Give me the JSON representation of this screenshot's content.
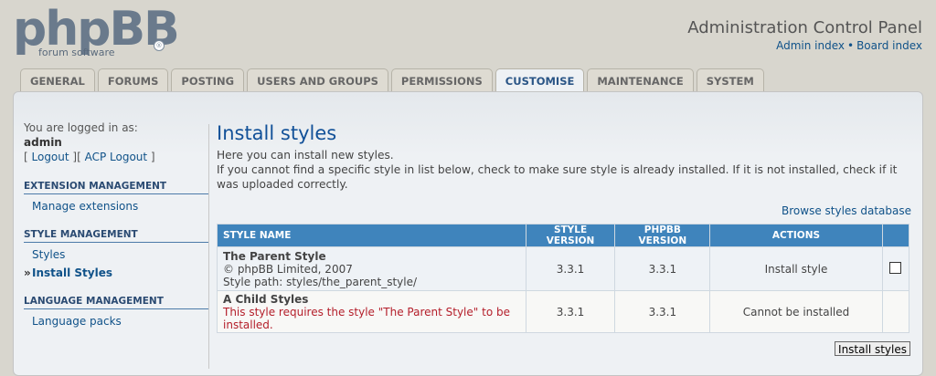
{
  "logo": {
    "text": "phpBB",
    "sub": "forum software",
    "mark": "®"
  },
  "header": {
    "title": "Administration Control Panel",
    "links": [
      "Admin index",
      "Board index"
    ],
    "separator": "•"
  },
  "tabs": [
    "GENERAL",
    "FORUMS",
    "POSTING",
    "USERS AND GROUPS",
    "PERMISSIONS",
    "CUSTOMISE",
    "MAINTENANCE",
    "SYSTEM"
  ],
  "active_tab": "CUSTOMISE",
  "sidebar": {
    "logged_in_label": "You are logged in as:",
    "username": "admin",
    "logout": "Logout",
    "acp_logout": "ACP Logout",
    "sections": [
      {
        "title": "EXTENSION MANAGEMENT",
        "items": [
          "Manage extensions"
        ]
      },
      {
        "title": "STYLE MANAGEMENT",
        "items": [
          "Styles",
          "Install Styles"
        ]
      },
      {
        "title": "LANGUAGE MANAGEMENT",
        "items": [
          "Language packs"
        ]
      }
    ],
    "active_item": "Install Styles"
  },
  "main": {
    "title": "Install styles",
    "desc1": "Here you can install new styles.",
    "desc2": "If you cannot find a specific style in list below, check to make sure style is already installed. If it is not installed, check if it was uploaded correctly.",
    "browse": "Browse styles database"
  },
  "table": {
    "headers": [
      "STYLE NAME",
      "STYLE VERSION",
      "PHPBB VERSION",
      "ACTIONS",
      ""
    ],
    "rows": [
      {
        "name": "The Parent Style",
        "copyright": "© phpBB Limited, 2007",
        "path": "Style path: styles/the_parent_style/",
        "style_version": "3.3.1",
        "phpbb_version": "3.3.1",
        "action": "Install style"
      },
      {
        "name": "A Child Styles",
        "warning": "This style requires the style \"The Parent Style\" to be installed.",
        "style_version": "3.3.1",
        "phpbb_version": "3.3.1",
        "action": "Cannot be installed"
      }
    ]
  },
  "submit_label": "Install styles"
}
